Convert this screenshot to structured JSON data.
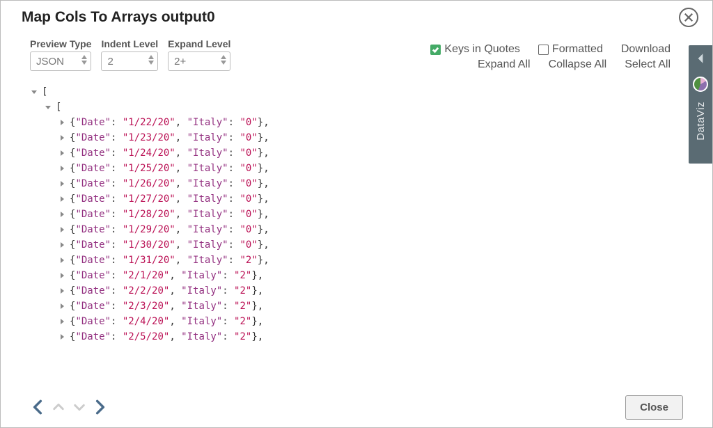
{
  "title": "Map Cols To Arrays output0",
  "controls": {
    "preview_type": {
      "label": "Preview Type",
      "value": "JSON"
    },
    "indent_level": {
      "label": "Indent Level",
      "value": "2"
    },
    "expand_level": {
      "label": "Expand Level",
      "value": "2+"
    }
  },
  "actions": {
    "keys_in_quotes": {
      "label": "Keys in Quotes",
      "checked": true
    },
    "formatted": {
      "label": "Formatted",
      "checked": false
    },
    "download": "Download",
    "expand_all": "Expand All",
    "collapse_all": "Collapse All",
    "select_all": "Select All"
  },
  "sidebar": {
    "label": "DataViz"
  },
  "footer": {
    "close_label": "Close"
  },
  "tree": {
    "root_bracket": "[",
    "child_bracket": "[",
    "key1": "\"Date\"",
    "key2": "\"Italy\"",
    "rows": [
      {
        "date": "\"1/22/20\"",
        "italy": "\"0\""
      },
      {
        "date": "\"1/23/20\"",
        "italy": "\"0\""
      },
      {
        "date": "\"1/24/20\"",
        "italy": "\"0\""
      },
      {
        "date": "\"1/25/20\"",
        "italy": "\"0\""
      },
      {
        "date": "\"1/26/20\"",
        "italy": "\"0\""
      },
      {
        "date": "\"1/27/20\"",
        "italy": "\"0\""
      },
      {
        "date": "\"1/28/20\"",
        "italy": "\"0\""
      },
      {
        "date": "\"1/29/20\"",
        "italy": "\"0\""
      },
      {
        "date": "\"1/30/20\"",
        "italy": "\"0\""
      },
      {
        "date": "\"1/31/20\"",
        "italy": "\"2\""
      },
      {
        "date": "\"2/1/20\"",
        "italy": "\"2\""
      },
      {
        "date": "\"2/2/20\"",
        "italy": "\"2\""
      },
      {
        "date": "\"2/3/20\"",
        "italy": "\"2\""
      },
      {
        "date": "\"2/4/20\"",
        "italy": "\"2\""
      },
      {
        "date": "\"2/5/20\"",
        "italy": "\"2\""
      }
    ]
  }
}
